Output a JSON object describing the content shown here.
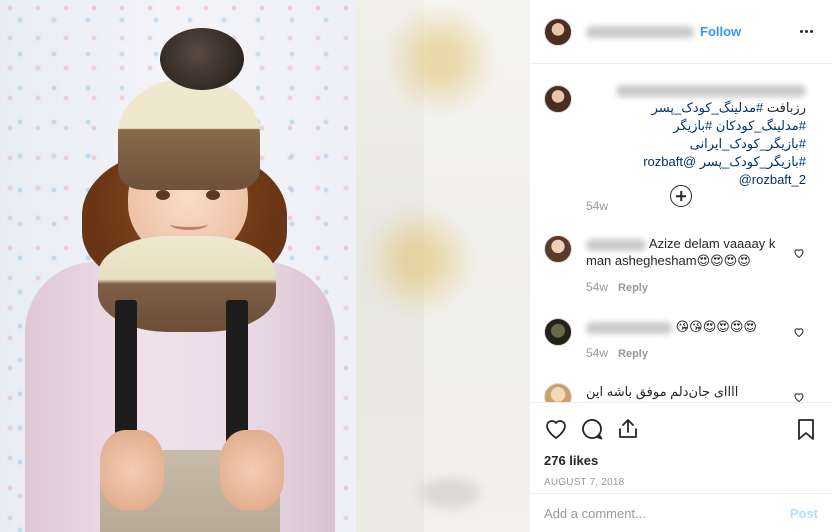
{
  "header": {
    "follow_label": "Follow"
  },
  "caption": {
    "text_parts": [
      "رزبافت ",
      "#مدلینگ_کودک_پسر",
      " ",
      "#مدلینگ_کودکان",
      " ",
      "#بازیگر",
      " ",
      "#بازیگر_کودک_ایرانی",
      " ",
      "#بازیگر_کودک_پسر",
      " ",
      "@rozbaft",
      " ",
      "@rozbaft_2"
    ],
    "time": "54w"
  },
  "comments": [
    {
      "text": "Azize delam vaaaay k man asheghesham😍😍😍😍",
      "time": "54w",
      "reply": "Reply"
    },
    {
      "text": "😘😘😍😍😍😍",
      "time": "54w",
      "reply": "Reply"
    },
    {
      "text": "اااای جان‌دلم موفق باشه این"
    }
  ],
  "likes": "276 likes",
  "date": "AUGUST 7, 2018",
  "add_comment": {
    "placeholder": "Add a comment...",
    "post_label": "Post"
  },
  "icons": [
    "heart-icon",
    "comment-icon",
    "share-icon",
    "bookmark-icon",
    "more-options-icon",
    "add-circle-icon"
  ],
  "colors": {
    "link": "#3897f0",
    "hashtag": "#003569",
    "muted": "#999999",
    "post_disabled": "#b2dffc"
  }
}
